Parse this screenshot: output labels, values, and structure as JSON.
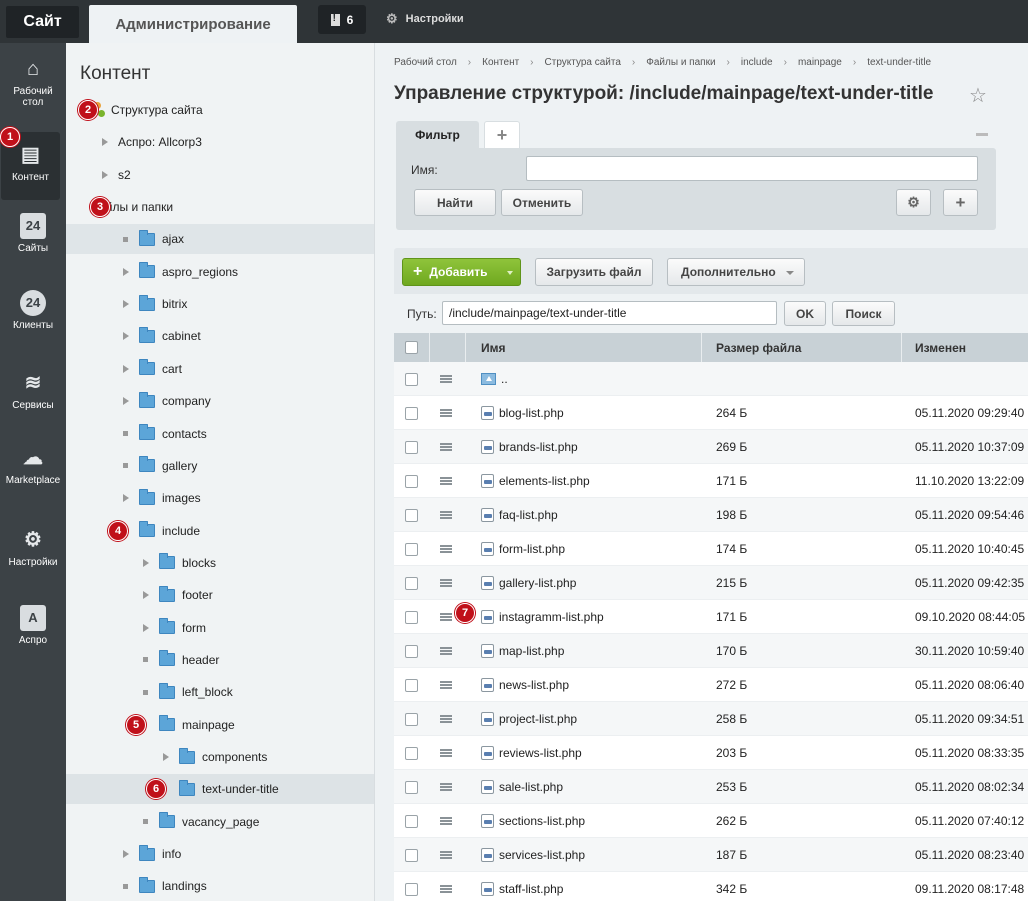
{
  "topbar": {
    "site_label": "Сайт",
    "admin_label": "Администрирование",
    "notifications_count": "6",
    "settings_label": "Настройки"
  },
  "rail": [
    {
      "label": "Рабочий стол",
      "icon": "home-icon"
    },
    {
      "label": "Контент",
      "icon": "document-icon",
      "active": true
    },
    {
      "label": "Сайты",
      "icon": "calendar-24-icon"
    },
    {
      "label": "Клиенты",
      "icon": "clients-24-icon"
    },
    {
      "label": "Сервисы",
      "icon": "layers-icon"
    },
    {
      "label": "Marketplace",
      "icon": "cloud-download-icon"
    },
    {
      "label": "Настройки",
      "icon": "gear-icon"
    },
    {
      "label": "Аспро",
      "icon": "letter-a-icon"
    }
  ],
  "tree": {
    "title": "Контент",
    "items": [
      {
        "label": "Структура сайта",
        "level": 0,
        "kind": "structure",
        "badge": "2"
      },
      {
        "label": "Аспро: Allcorp3",
        "level": 1,
        "kind": "text-arrow"
      },
      {
        "label": "s2",
        "level": 1,
        "kind": "text-arrow"
      },
      {
        "label": "Файлы и папки",
        "level": 0,
        "kind": "text",
        "badge": "3"
      },
      {
        "label": "ajax",
        "level": 1,
        "kind": "folder-leaf",
        "highlight": true
      },
      {
        "label": "aspro_regions",
        "level": 1,
        "kind": "folder"
      },
      {
        "label": "bitrix",
        "level": 1,
        "kind": "folder"
      },
      {
        "label": "cabinet",
        "level": 1,
        "kind": "folder"
      },
      {
        "label": "cart",
        "level": 1,
        "kind": "folder"
      },
      {
        "label": "company",
        "level": 1,
        "kind": "folder"
      },
      {
        "label": "contacts",
        "level": 1,
        "kind": "folder-leaf"
      },
      {
        "label": "gallery",
        "level": 1,
        "kind": "folder-leaf"
      },
      {
        "label": "images",
        "level": 1,
        "kind": "folder"
      },
      {
        "label": "include",
        "level": 1,
        "kind": "folder-open",
        "badge": "4"
      },
      {
        "label": "blocks",
        "level": 2,
        "kind": "folder"
      },
      {
        "label": "footer",
        "level": 2,
        "kind": "folder"
      },
      {
        "label": "form",
        "level": 2,
        "kind": "folder"
      },
      {
        "label": "header",
        "level": 2,
        "kind": "folder-leaf"
      },
      {
        "label": "left_block",
        "level": 2,
        "kind": "folder-leaf"
      },
      {
        "label": "mainpage",
        "level": 2,
        "kind": "folder-open",
        "badge": "5"
      },
      {
        "label": "components",
        "level": 3,
        "kind": "folder"
      },
      {
        "label": "text-under-title",
        "level": 3,
        "kind": "folder-open",
        "badge": "6",
        "selected": true
      },
      {
        "label": "vacancy_page",
        "level": 2,
        "kind": "folder-leaf"
      },
      {
        "label": "info",
        "level": 1,
        "kind": "folder"
      },
      {
        "label": "landings",
        "level": 1,
        "kind": "folder-leaf"
      }
    ]
  },
  "badges": {
    "content_rail": "1",
    "file_row": "7"
  },
  "breadcrumbs": [
    "Рабочий стол",
    "Контент",
    "Структура сайта",
    "Файлы и папки",
    "include",
    "mainpage",
    "text-under-title"
  ],
  "page_title": "Управление структурой: /include/mainpage/text-under-title",
  "filter": {
    "tab_label": "Фильтр",
    "add_tab_label": "+",
    "name_label": "Имя:",
    "name_value": "",
    "find_label": "Найти",
    "cancel_label": "Отменить"
  },
  "toolbar": {
    "add_label": "Добавить",
    "upload_label": "Загрузить файл",
    "more_label": "Дополнительно"
  },
  "pathbar": {
    "label": "Путь:",
    "value": "/include/mainpage/text-under-title",
    "ok_label": "OK",
    "search_label": "Поиск"
  },
  "table": {
    "columns": [
      "Имя",
      "Размер файла",
      "Изменен"
    ],
    "up_label": "..",
    "rows": [
      {
        "name": "blog-list.php",
        "size": "264 Б",
        "modified": "05.11.2020 09:29:40"
      },
      {
        "name": "brands-list.php",
        "size": "269 Б",
        "modified": "05.11.2020 10:37:09"
      },
      {
        "name": "elements-list.php",
        "size": "171 Б",
        "modified": "11.10.2020 13:22:09"
      },
      {
        "name": "faq-list.php",
        "size": "198 Б",
        "modified": "05.11.2020 09:54:46"
      },
      {
        "name": "form-list.php",
        "size": "174 Б",
        "modified": "05.11.2020 10:40:45"
      },
      {
        "name": "gallery-list.php",
        "size": "215 Б",
        "modified": "05.11.2020 09:42:35"
      },
      {
        "name": "instagramm-list.php",
        "size": "171 Б",
        "modified": "09.10.2020 08:44:05"
      },
      {
        "name": "map-list.php",
        "size": "170 Б",
        "modified": "30.11.2020 10:59:40"
      },
      {
        "name": "news-list.php",
        "size": "272 Б",
        "modified": "05.11.2020 08:06:40"
      },
      {
        "name": "project-list.php",
        "size": "258 Б",
        "modified": "05.11.2020 09:34:51"
      },
      {
        "name": "reviews-list.php",
        "size": "203 Б",
        "modified": "05.11.2020 08:33:35"
      },
      {
        "name": "sale-list.php",
        "size": "253 Б",
        "modified": "05.11.2020 08:02:34"
      },
      {
        "name": "sections-list.php",
        "size": "262 Б",
        "modified": "05.11.2020 07:40:12"
      },
      {
        "name": "services-list.php",
        "size": "187 Б",
        "modified": "05.11.2020 08:23:40"
      },
      {
        "name": "staff-list.php",
        "size": "342 Б",
        "modified": "09.11.2020 08:17:48"
      }
    ]
  },
  "colors": {
    "accent_green": "#7ab42c",
    "badge_red": "#c0101a",
    "folder_blue": "#5ca5d8"
  }
}
